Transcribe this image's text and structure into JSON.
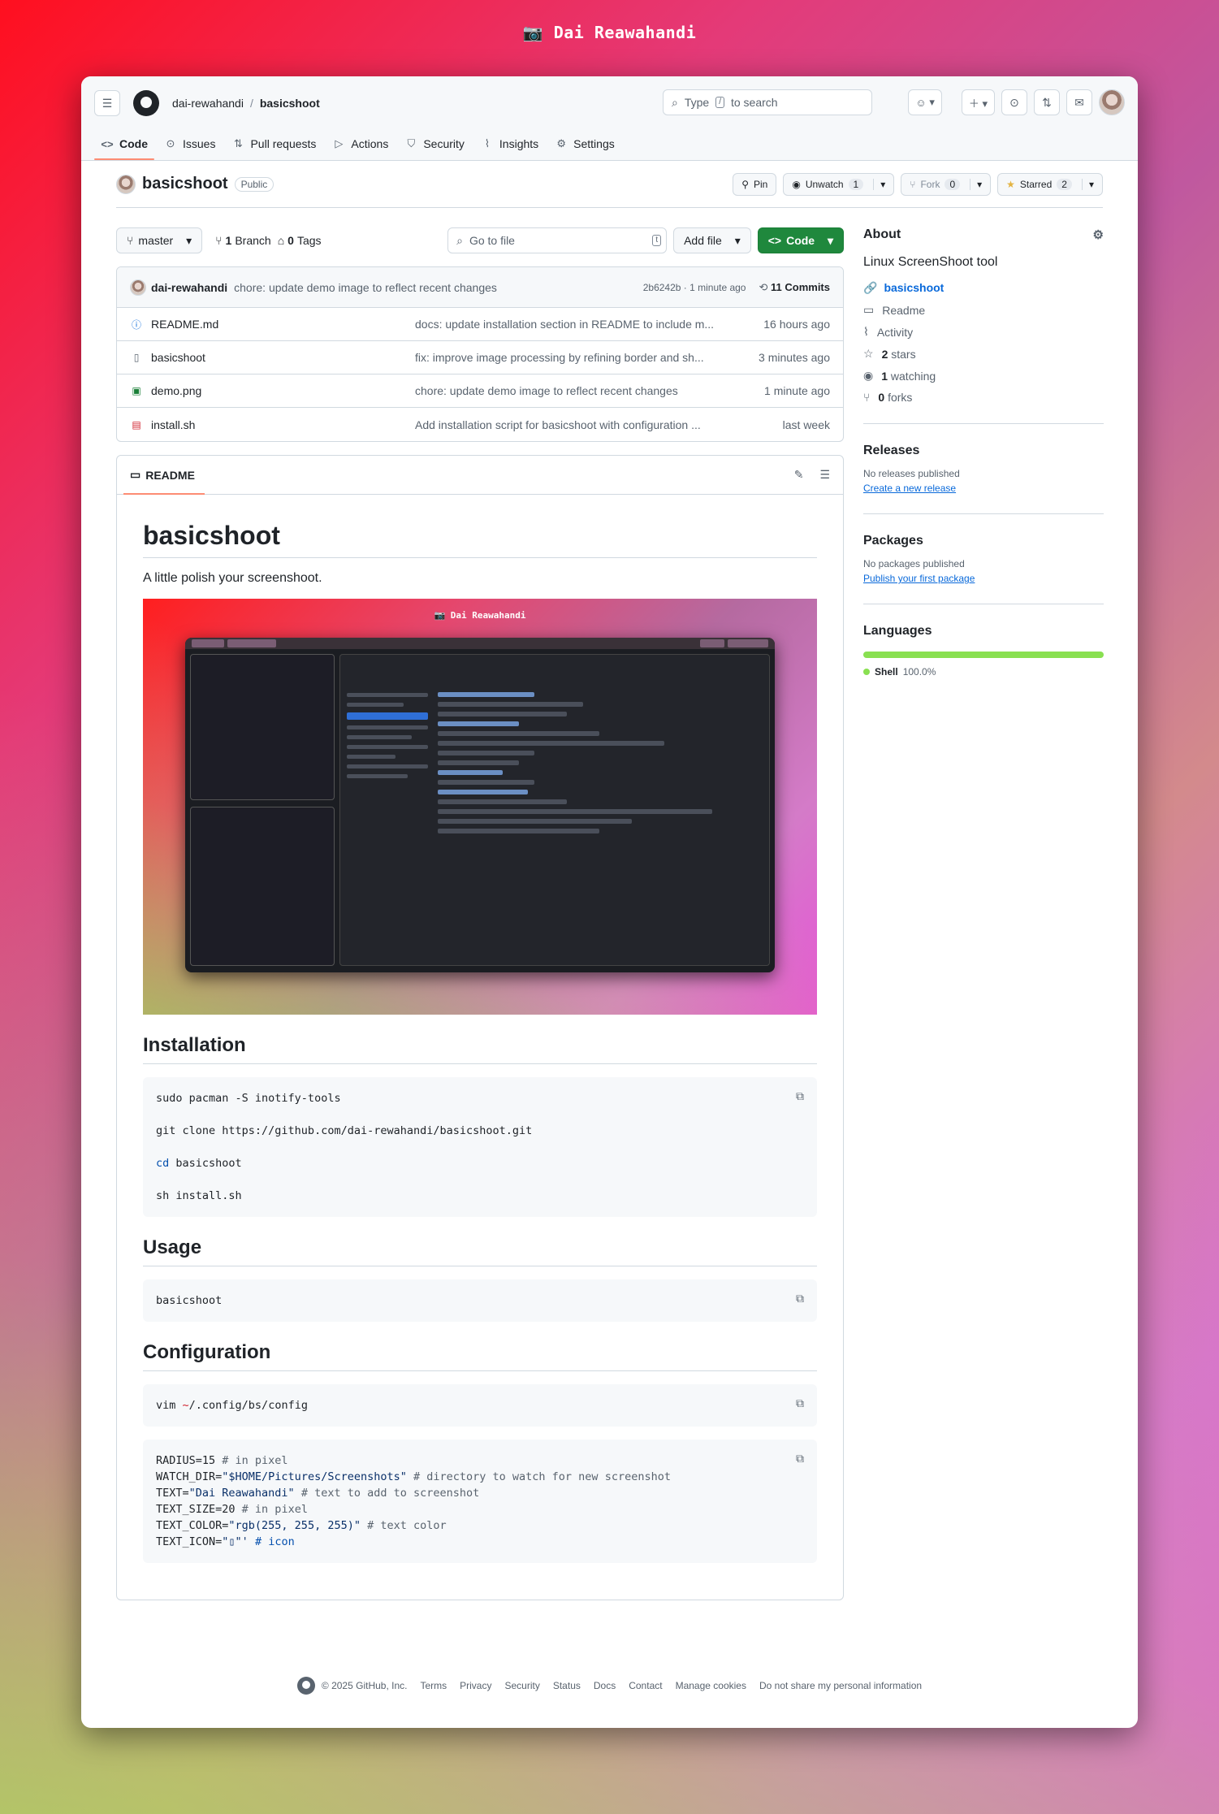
{
  "top_title": "Dai Reawahandi",
  "header": {
    "owner": "dai-rewahandi",
    "separator": "/",
    "repo": "basicshoot",
    "search_pre": "Type",
    "search_key": "/",
    "search_post": "to search",
    "tabs": [
      {
        "label": "Code",
        "icon": "code-icon"
      },
      {
        "label": "Issues",
        "icon": "issue-icon"
      },
      {
        "label": "Pull requests",
        "icon": "pull-request-icon"
      },
      {
        "label": "Actions",
        "icon": "play-icon"
      },
      {
        "label": "Security",
        "icon": "shield-icon"
      },
      {
        "label": "Insights",
        "icon": "graph-icon"
      },
      {
        "label": "Settings",
        "icon": "gear-icon"
      }
    ]
  },
  "repo": {
    "name": "basicshoot",
    "visibility": "Public",
    "pin": "Pin",
    "unwatch": "Unwatch",
    "watch_count": "1",
    "fork": "Fork",
    "fork_count": "0",
    "starred": "Starred",
    "star_count": "2"
  },
  "controls": {
    "branch": "master",
    "branches_count": "1",
    "branches_label": "Branch",
    "tags_count": "0",
    "tags_label": "Tags",
    "goto_placeholder": "Go to file",
    "goto_key": "t",
    "add_file": "Add file",
    "code": "Code"
  },
  "commit": {
    "author": "dai-rewahandi",
    "message": "chore: update demo image to reflect recent changes",
    "hash_time": "2b6242b · 1 minute ago",
    "count": "11 Commits"
  },
  "files": [
    {
      "name": "README.md",
      "message": "docs: update installation section in README to include m...",
      "time": "16 hours ago",
      "icon": "info-icon"
    },
    {
      "name": "basicshoot",
      "message": "fix: improve image processing by refining border and sh...",
      "time": "3 minutes ago",
      "icon": "file-icon"
    },
    {
      "name": "demo.png",
      "message": "chore: update demo image to reflect recent changes",
      "time": "1 minute ago",
      "icon": "image-file-icon"
    },
    {
      "name": "install.sh",
      "message": "Add installation script for basicshoot with configuration ...",
      "time": "last week",
      "icon": "terminal-file-icon"
    }
  ],
  "readme": {
    "tab": "README",
    "title": "basicshoot",
    "intro": "A little polish your screenshoot.",
    "demo_title": "Dai Reawahandi",
    "installation": "Installation",
    "install_lines": {
      "l1": "sudo pacman -S inotify-tools",
      "l2": "git clone https://github.com/dai-rewahandi/basicshoot.git",
      "l3_cmd": "cd",
      "l3_arg": " basicshoot",
      "l4": "sh install.sh"
    },
    "usage": "Usage",
    "usage_line": "basicshoot",
    "configuration": "Configuration",
    "config_cmd": "vim ",
    "config_tilde": "~",
    "config_path": "/.config/bs/config",
    "config": {
      "r1a": "RADIUS=15 ",
      "r1c": "# in pixel",
      "r2a": "WATCH_DIR=",
      "r2s": "\"$HOME/Pictures/Screenshots\"",
      "r2c": " # directory to watch for new screenshot",
      "r3a": "TEXT=",
      "r3s": "\"Dai Reawahandi\"",
      "r3c": " # text to add to screenshot",
      "r4a": "TEXT_SIZE=20 ",
      "r4c": "# in pixel",
      "r5a": "TEXT_COLOR=",
      "r5s": "\"rgb(255, 255, 255)\"",
      "r5c": " # text color",
      "r6a": "TEXT_ICON=",
      "r6s": "\"▯\"",
      "r6q": "'",
      "r6c": " # icon"
    }
  },
  "sidebar": {
    "about": "About",
    "description": "Linux ScreenShoot tool",
    "link": "basicshoot",
    "readme": "Readme",
    "activity": "Activity",
    "stars_count": "2",
    "stars": "stars",
    "watching_count": "1",
    "watching": "watching",
    "forks_count": "0",
    "forks": "forks",
    "releases": "Releases",
    "no_releases": "No releases published",
    "create_release": "Create a new release",
    "packages": "Packages",
    "no_packages": "No packages published",
    "publish_package": "Publish your first package",
    "languages": "Languages",
    "lang_name": "Shell",
    "lang_pct": "100.0%",
    "lang_color": "#89e051"
  },
  "footer": {
    "copyright": "© 2025 GitHub, Inc.",
    "links": [
      "Terms",
      "Privacy",
      "Security",
      "Status",
      "Docs",
      "Contact",
      "Manage cookies",
      "Do not share my personal information"
    ]
  }
}
